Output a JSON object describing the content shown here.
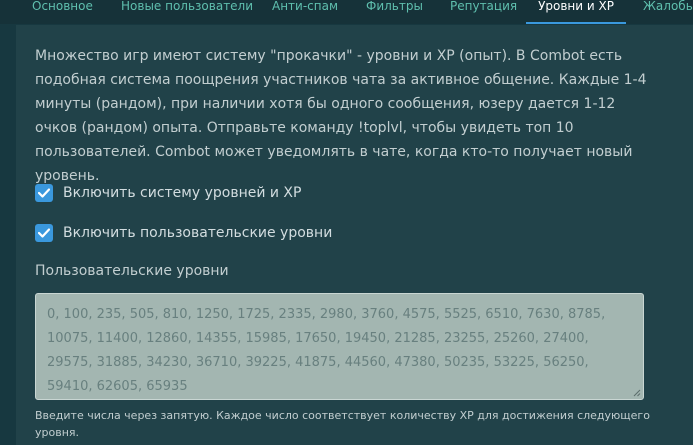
{
  "tabs": [
    {
      "label": "Основное"
    },
    {
      "label": "Новые пользователи"
    },
    {
      "label": "Анти-спам"
    },
    {
      "label": "Фильтры"
    },
    {
      "label": "Репутация"
    },
    {
      "label": "Уровни и XP"
    },
    {
      "label": "Жалобы"
    }
  ],
  "active_tab": "Уровни и XP",
  "description": "Множество игр имеют систему \"прокачки\" - уровни и XP (опыт). В Combot есть подобная система поощрения участников чата за активное общение. Каждые 1-4 минуты (рандом), при наличии хотя бы одного сообщения, юзеру дается 1-12 очков (рандом) опыта. Отправьте команду !toplvl, чтобы увидеть топ 10 пользователей. Combot может уведомлять в чате, когда кто-то получает новый уровень.",
  "options": {
    "enable_levels": {
      "label": "Включить систему уровней и XP",
      "checked": true
    },
    "enable_custom_levels": {
      "label": "Включить пользовательские уровни",
      "checked": true
    }
  },
  "custom_levels": {
    "label": "Пользовательские уровни",
    "value": "0, 100, 235, 505, 810, 1250, 1725, 2335, 2980, 3760, 4575, 5525, 6510, 7630, 8785, 10075, 11400, 12860, 14355, 15985, 17650, 19450, 21285, 23255, 25260, 27400, 29575, 31885, 34230, 36710, 39225, 41875, 44560, 47380, 50235, 53225, 56250, 59410, 62605, 65935",
    "hint": "Введите числа через запятую. Каждое число соответствует количеству XP для достижения следующего уровня."
  },
  "colors": {
    "accent": "#3a98dd",
    "tab_text": "#5fbfae",
    "background": "#173840",
    "panel": "#214249"
  }
}
